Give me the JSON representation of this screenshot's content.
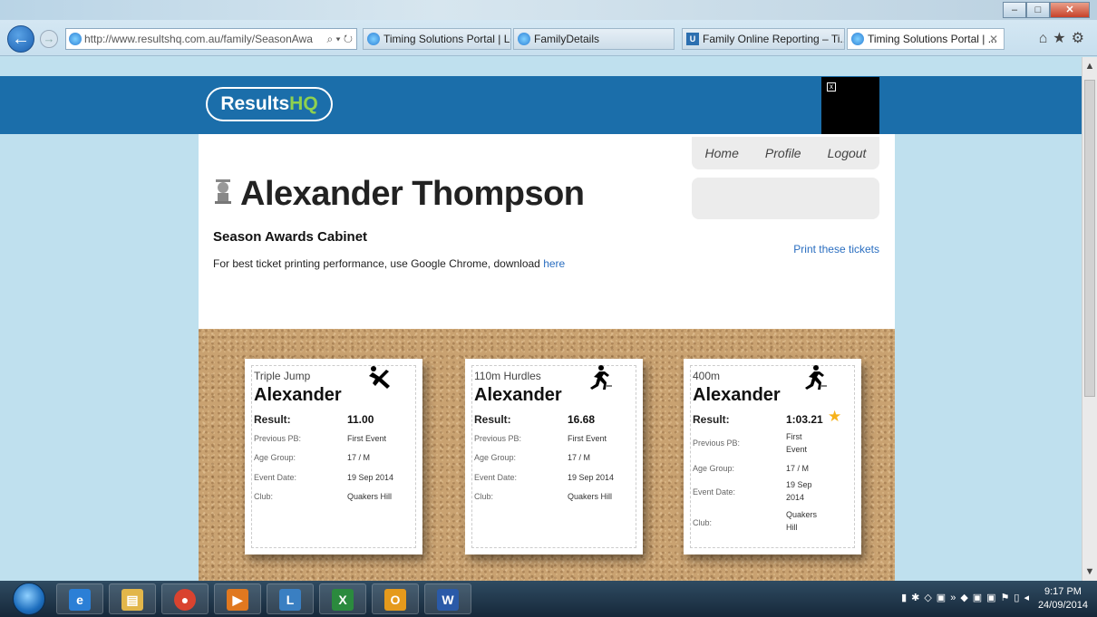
{
  "browser": {
    "address": "http://www.resultshq.com.au/family/SeasonAwa",
    "address_domain": "resultshq.com.au",
    "tabs": [
      {
        "label": "Timing Solutions Portal | Log..."
      },
      {
        "label": "FamilyDetails"
      },
      {
        "label": "Family Online Reporting – Ti..."
      },
      {
        "label": "Timing Solutions Portal | ..."
      }
    ]
  },
  "site": {
    "logo_main": "Results",
    "logo_accent": "HQ"
  },
  "menu": {
    "home": "Home",
    "profile": "Profile",
    "logout": "Logout"
  },
  "page": {
    "athlete_name": "Alexander Thompson",
    "subtitle": "Season Awards Cabinet",
    "print_link": "Print these tickets",
    "notice_text": "For best ticket printing performance, use Google Chrome, download ",
    "notice_link": "here"
  },
  "labels": {
    "result": "Result:",
    "previous_pb": "Previous PB:",
    "age_group": "Age Group:",
    "event_date": "Event Date:",
    "club": "Club:"
  },
  "tickets": [
    {
      "event": "Triple Jump",
      "first_name": "Alexander",
      "result": "11.00",
      "previous_pb": "First Event",
      "age_group": "17 / M",
      "event_date": "19 Sep 2014",
      "club": "Quakers Hill",
      "icon": "triple-jump-icon",
      "pb_star": false
    },
    {
      "event": "110m Hurdles",
      "first_name": "Alexander",
      "result": "16.68",
      "previous_pb": "First Event",
      "age_group": "17 / M",
      "event_date": "19 Sep 2014",
      "club": "Quakers Hill",
      "icon": "runner-icon",
      "pb_star": false
    },
    {
      "event": "400m",
      "first_name": "Alexander",
      "result": "1:03.21",
      "previous_pb_lines": [
        "First",
        "Event"
      ],
      "age_group": "17 / M",
      "event_date_lines": [
        "19 Sep",
        "2014"
      ],
      "club_lines": [
        "Quakers",
        "Hill"
      ],
      "icon": "runner-icon",
      "pb_star": true
    }
  ],
  "taskbar": {
    "time": "9:17 PM",
    "date": "24/09/2014"
  },
  "colors": {
    "header_blue": "#1b6eaa",
    "logo_green": "#8fd14f",
    "link_blue": "#2a6ec0",
    "cork": "#c9a271",
    "star": "#f6b21b"
  }
}
